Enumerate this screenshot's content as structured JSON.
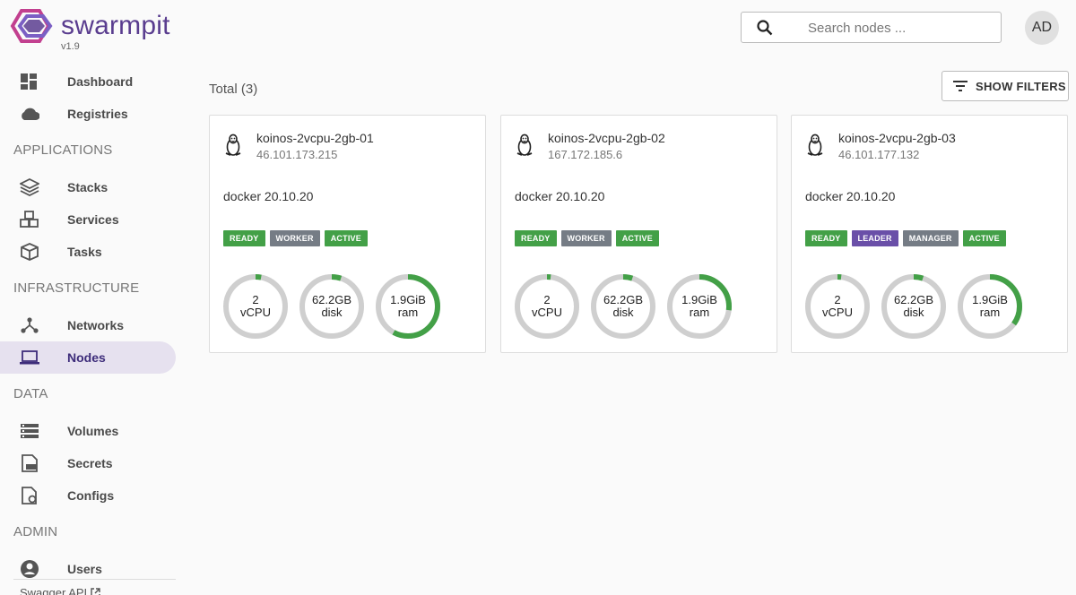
{
  "app": {
    "name": "swarmpit",
    "version": "v1.9"
  },
  "sidebar": {
    "items_top": [
      {
        "label": "Dashboard",
        "icon": "dashboard-icon"
      },
      {
        "label": "Registries",
        "icon": "cloud-icon"
      }
    ],
    "sections": [
      {
        "title": "APPLICATIONS",
        "items": [
          {
            "label": "Stacks",
            "icon": "layers-icon"
          },
          {
            "label": "Services",
            "icon": "cubes-icon"
          },
          {
            "label": "Tasks",
            "icon": "cube-icon"
          }
        ]
      },
      {
        "title": "INFRASTRUCTURE",
        "items": [
          {
            "label": "Networks",
            "icon": "network-icon"
          },
          {
            "label": "Nodes",
            "icon": "laptop-icon",
            "active": true
          }
        ]
      },
      {
        "title": "DATA",
        "items": [
          {
            "label": "Volumes",
            "icon": "storage-icon"
          },
          {
            "label": "Secrets",
            "icon": "key-icon"
          },
          {
            "label": "Configs",
            "icon": "settings-file-icon"
          }
        ]
      },
      {
        "title": "ADMIN",
        "items": [
          {
            "label": "Users",
            "icon": "account-icon"
          }
        ]
      }
    ],
    "swagger_label": "Swagger API"
  },
  "header": {
    "search_placeholder": "Search nodes ...",
    "avatar_initials": "AD"
  },
  "main": {
    "total_label": "Total (3)",
    "filters_label": "SHOW FILTERS"
  },
  "colors": {
    "accent": "#5a3d8f",
    "ready": "#43a047",
    "role": "#757c85",
    "leader": "#6a4fa8",
    "gauge_track": "#cfcfcf",
    "gauge_fill": "#43a047"
  },
  "nodes": [
    {
      "name": "koinos-2vcpu-2gb-01",
      "ip": "46.101.173.215",
      "docker": "docker 20.10.20",
      "badges": [
        {
          "label": "READY",
          "color": "green"
        },
        {
          "label": "WORKER",
          "color": "gray"
        },
        {
          "label": "ACTIVE",
          "color": "green"
        }
      ],
      "gauges": [
        {
          "value": "2",
          "unit": "vCPU",
          "fraction": 0.03
        },
        {
          "value": "62.2GB",
          "unit": "disk",
          "fraction": 0.05
        },
        {
          "value": "1.9GiB",
          "unit": "ram",
          "fraction": 0.58
        }
      ]
    },
    {
      "name": "koinos-2vcpu-2gb-02",
      "ip": "167.172.185.6",
      "docker": "docker 20.10.20",
      "badges": [
        {
          "label": "READY",
          "color": "green"
        },
        {
          "label": "WORKER",
          "color": "gray"
        },
        {
          "label": "ACTIVE",
          "color": "green"
        }
      ],
      "gauges": [
        {
          "value": "2",
          "unit": "vCPU",
          "fraction": 0.02
        },
        {
          "value": "62.2GB",
          "unit": "disk",
          "fraction": 0.05
        },
        {
          "value": "1.9GiB",
          "unit": "ram",
          "fraction": 0.27
        }
      ]
    },
    {
      "name": "koinos-2vcpu-2gb-03",
      "ip": "46.101.177.132",
      "docker": "docker 20.10.20",
      "badges": [
        {
          "label": "READY",
          "color": "green"
        },
        {
          "label": "LEADER",
          "color": "purple"
        },
        {
          "label": "MANAGER",
          "color": "gray"
        },
        {
          "label": "ACTIVE",
          "color": "green"
        }
      ],
      "gauges": [
        {
          "value": "2",
          "unit": "vCPU",
          "fraction": 0.02
        },
        {
          "value": "62.2GB",
          "unit": "disk",
          "fraction": 0.05
        },
        {
          "value": "1.9GiB",
          "unit": "ram",
          "fraction": 0.35
        }
      ]
    }
  ]
}
